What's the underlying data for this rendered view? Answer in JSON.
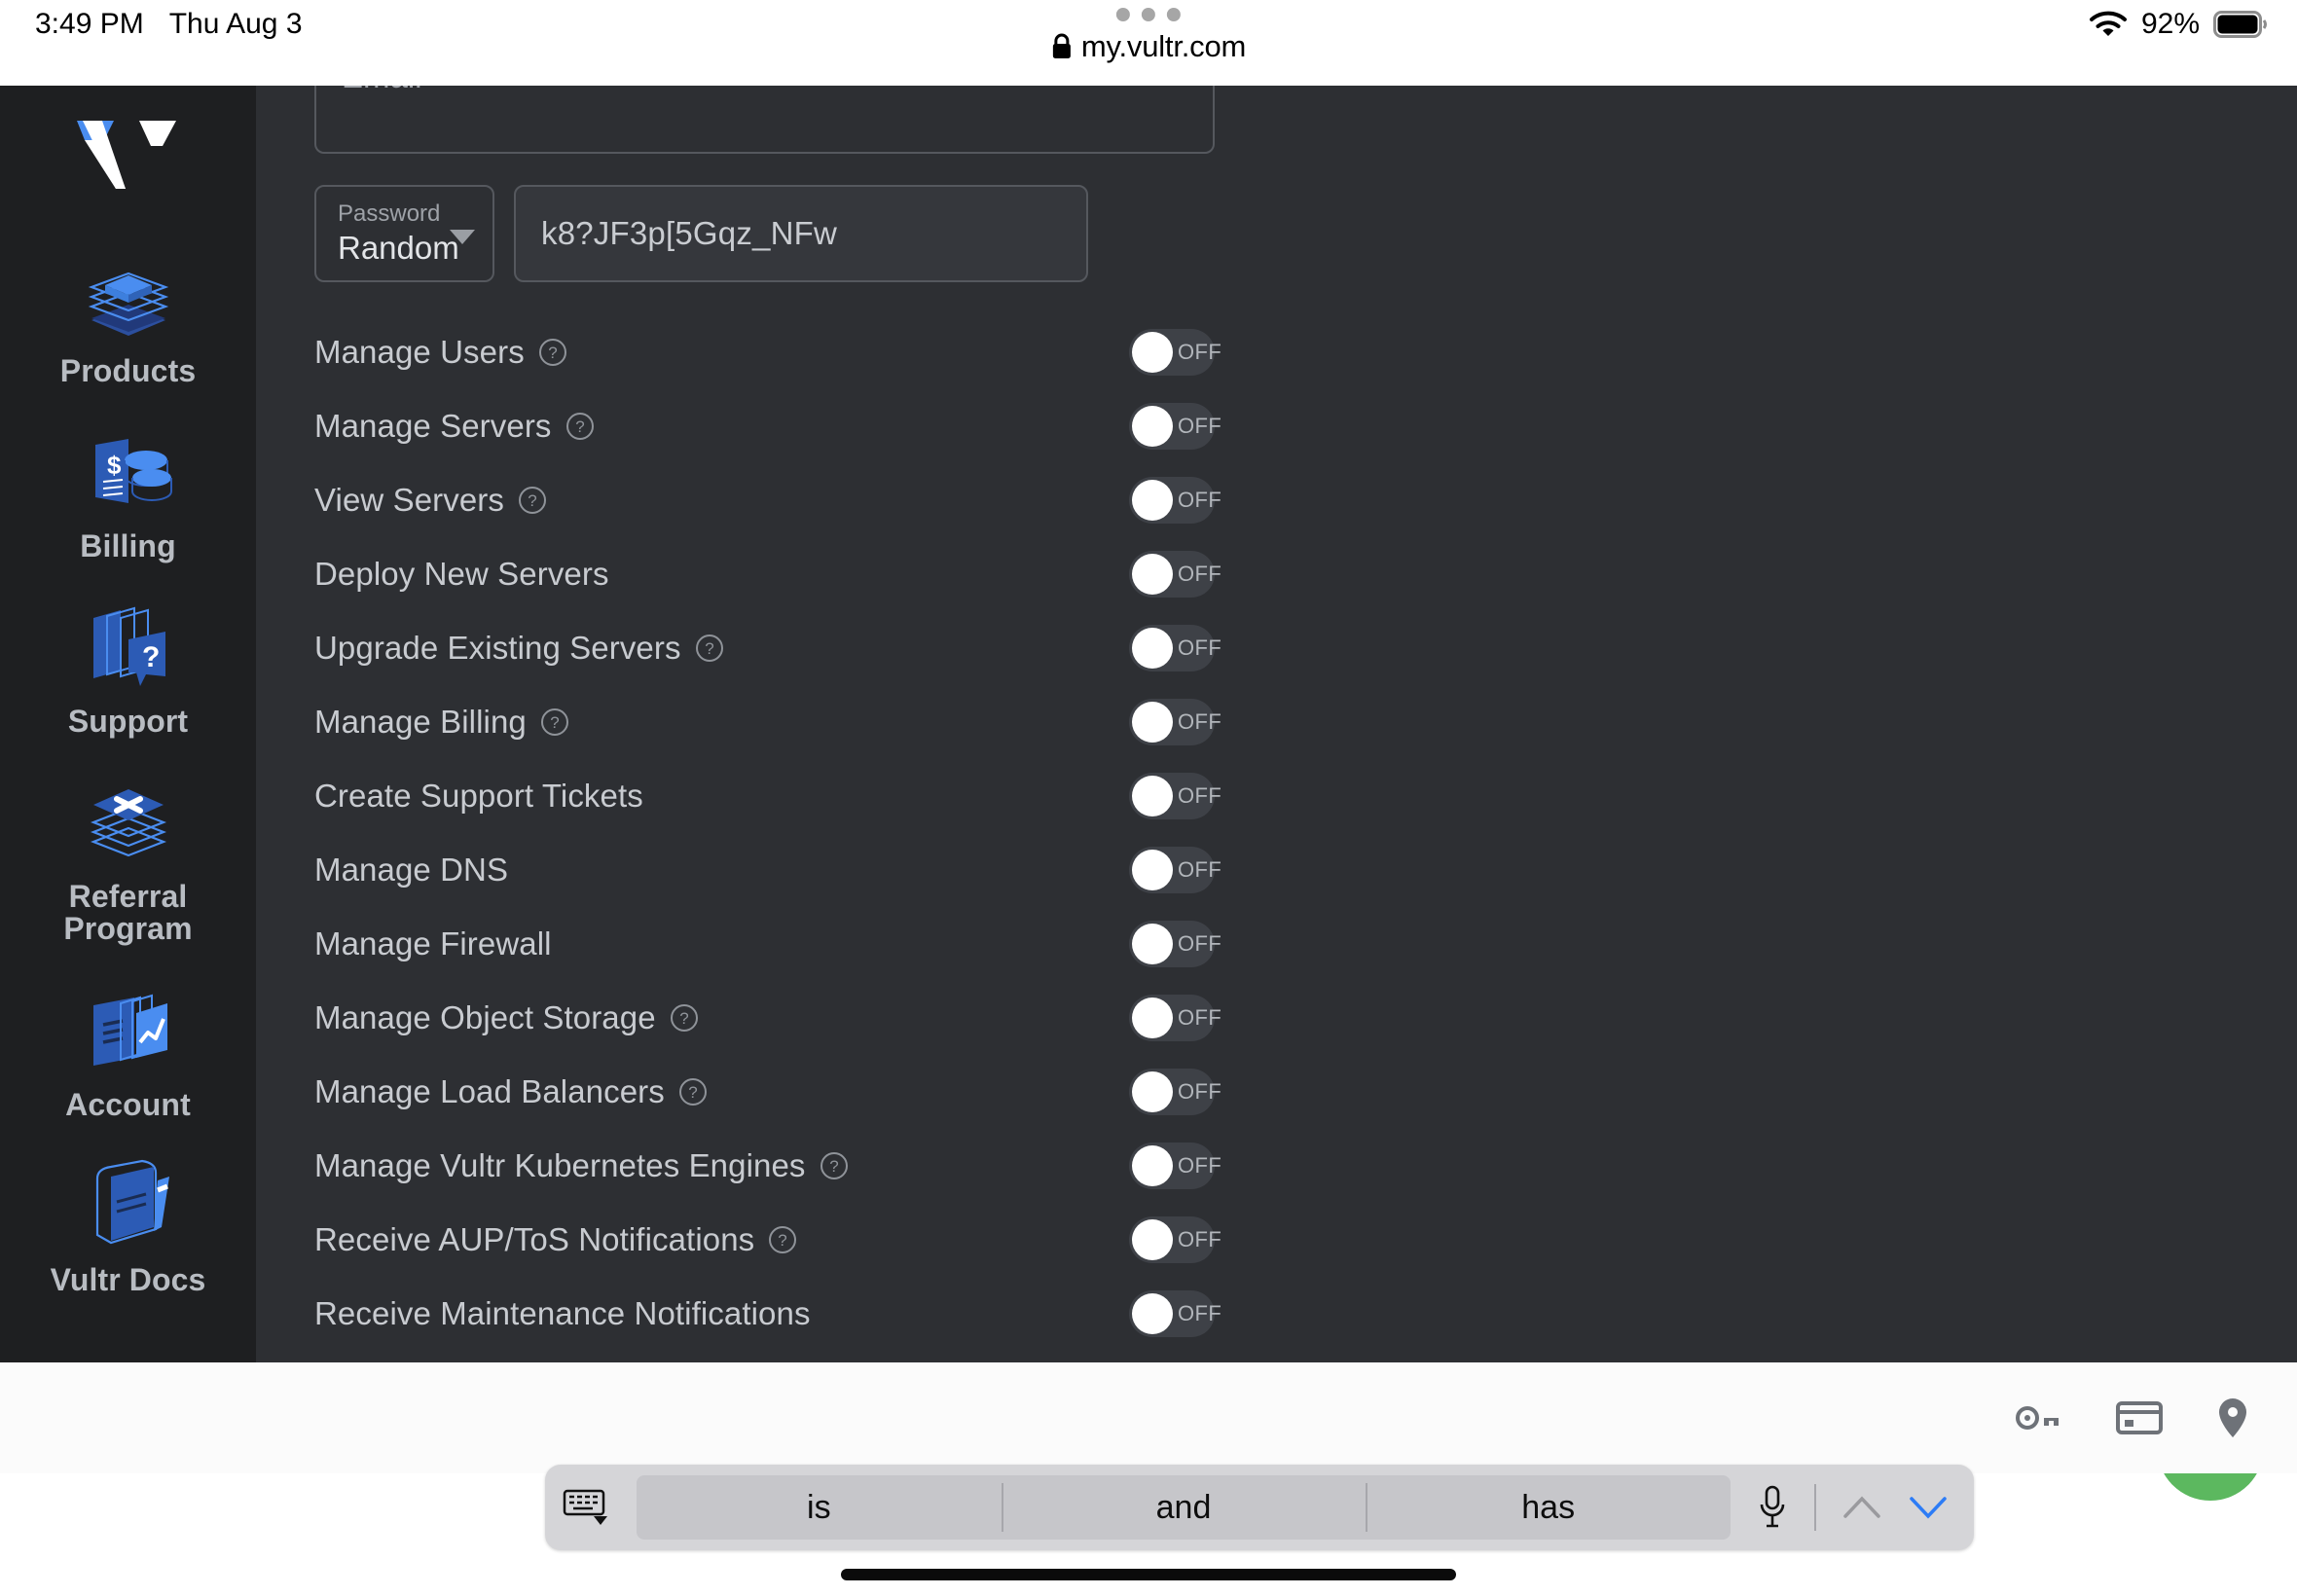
{
  "status_bar": {
    "time": "3:49 PM",
    "date": "Thu Aug 3",
    "battery_percent": "92%",
    "wifi_icon": "wifi-icon",
    "battery_icon": "battery-icon"
  },
  "browser": {
    "url": "my.vultr.com",
    "lock_icon": "lock-icon",
    "tab_handle_icon": "tab-handle-dots",
    "toolbar_icons": [
      "key-icon",
      "credit-card-icon",
      "location-pin-icon"
    ]
  },
  "sidebar": {
    "logo": "vultr-logo",
    "items": [
      {
        "label": "Products",
        "icon": "products-icon"
      },
      {
        "label": "Billing",
        "icon": "billing-icon"
      },
      {
        "label": "Support",
        "icon": "support-icon"
      },
      {
        "label": "Referral Program",
        "icon": "referral-icon"
      },
      {
        "label": "Account",
        "icon": "account-icon"
      },
      {
        "label": "Vultr Docs",
        "icon": "docs-icon"
      }
    ]
  },
  "form": {
    "email": {
      "placeholder": "Email",
      "value": ""
    },
    "password_type": {
      "label": "Password",
      "value": "Random"
    },
    "password_value": "k8?JF3p[5Gqz_NFw"
  },
  "permissions": [
    {
      "label": "Manage Users",
      "has_help": true,
      "state": "OFF"
    },
    {
      "label": "Manage Servers",
      "has_help": true,
      "state": "OFF"
    },
    {
      "label": "View Servers",
      "has_help": true,
      "state": "OFF"
    },
    {
      "label": "Deploy New Servers",
      "has_help": false,
      "state": "OFF"
    },
    {
      "label": "Upgrade Existing Servers",
      "has_help": true,
      "state": "OFF"
    },
    {
      "label": "Manage Billing",
      "has_help": true,
      "state": "OFF"
    },
    {
      "label": "Create Support Tickets",
      "has_help": false,
      "state": "OFF"
    },
    {
      "label": "Manage DNS",
      "has_help": false,
      "state": "OFF"
    },
    {
      "label": "Manage Firewall",
      "has_help": false,
      "state": "OFF"
    },
    {
      "label": "Manage Object Storage",
      "has_help": true,
      "state": "OFF"
    },
    {
      "label": "Manage Load Balancers",
      "has_help": true,
      "state": "OFF"
    },
    {
      "label": "Manage Vultr Kubernetes Engines",
      "has_help": true,
      "state": "OFF"
    },
    {
      "label": "Receive AUP/ToS Notifications",
      "has_help": true,
      "state": "OFF"
    },
    {
      "label": "Receive Maintenance Notifications",
      "has_help": false,
      "state": "OFF"
    }
  ],
  "submit_button": {
    "label": "",
    "color": "#3b7ef0"
  },
  "support_widget": {
    "icon": "chat-bubble-icon",
    "color": "#5cb85f"
  },
  "keyboard": {
    "dictation_icon": "microphone-icon",
    "hide_keyboard_icon": "keyboard-dismiss-icon",
    "prev_icon": "chevron-up-icon",
    "next_icon": "chevron-down-icon",
    "predictions": [
      "is",
      "and",
      "has"
    ]
  },
  "colors": {
    "page_bg": "#2d2f33",
    "sidebar_bg": "#1e1f21",
    "accent_blue": "#3b7ef0",
    "toggle_track": "#3e4147",
    "text_primary": "#c8cbd0"
  }
}
